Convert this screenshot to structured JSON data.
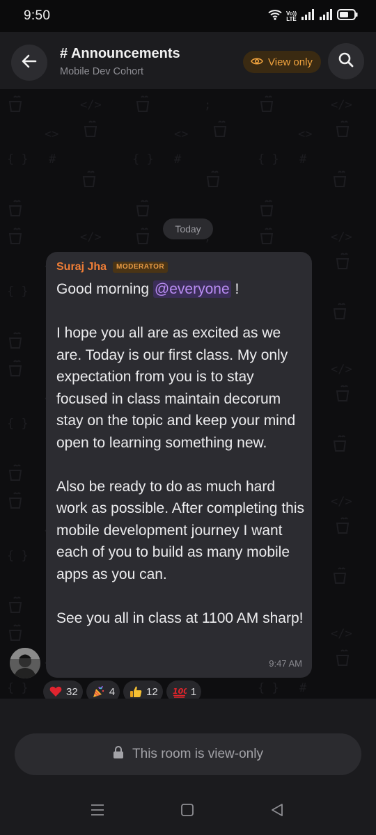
{
  "status_bar": {
    "time": "9:50",
    "volte_line1": "Vo))",
    "volte_line2": "LTE",
    "icons": [
      "wifi-icon",
      "volte-icon",
      "signal-icon",
      "signal-icon",
      "battery-icon"
    ]
  },
  "header": {
    "title": "# Announcements",
    "subtitle": "Mobile Dev Cohort",
    "view_only_label": "View only",
    "accent_color": "#f0a33e",
    "icons": [
      "back-arrow-icon",
      "eye-icon",
      "search-icon"
    ]
  },
  "chat": {
    "date_separator": "Today",
    "message": {
      "sender": "Suraj Jha",
      "role_badge": "MODERATOR",
      "greeting_prefix": "Good morning ",
      "mention": "@everyone",
      "greeting_suffix": " !",
      "paragraph_1": "I hope you all are as excited as we are. Today is our first class. My only expectation from you is to stay focused in class maintain decorum stay on the topic and keep your mind open to learning something new.",
      "paragraph_2": "Also be ready to do as much hard work as possible. After completing this mobile development journey I want each of you to build as many mobile apps as you can.",
      "paragraph_3": "See you all in class at 1100 AM sharp!",
      "time": "9:47 AM",
      "sender_color": "#ee7d36",
      "mention_color": "#b98cf3"
    },
    "reactions": [
      {
        "emoji": "heart-icon",
        "count": "32"
      },
      {
        "emoji": "party-popper-icon",
        "count": "4"
      },
      {
        "emoji": "thumbs-up-icon",
        "count": "12"
      },
      {
        "emoji": "hundred-points-icon",
        "count": "1"
      }
    ],
    "background_pattern": [
      "coffee-cup-icon",
      "code-brackets-icon",
      "curly-braces-icon",
      "hash-icon",
      "semicolon-icon"
    ]
  },
  "composer": {
    "notice": "This room is view-only",
    "icon": "lock-icon"
  },
  "nav_bar": {
    "icons": [
      "recents-icon",
      "home-icon",
      "back-icon"
    ]
  }
}
